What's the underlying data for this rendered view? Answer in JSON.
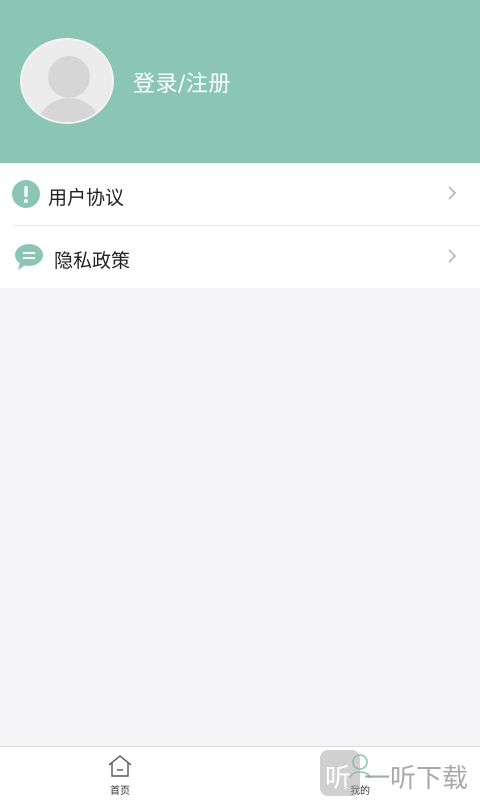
{
  "profile": {
    "login_label": "登录/注册"
  },
  "menu": {
    "items": [
      {
        "label": "用户协议",
        "icon": "exclamation-icon"
      },
      {
        "label": "隐私政策",
        "icon": "chat-bubble-icon"
      }
    ]
  },
  "tabbar": {
    "tabs": [
      {
        "label": "首页",
        "icon": "home-icon",
        "active": false
      },
      {
        "label": "我的",
        "icon": "user-icon",
        "active": true
      }
    ]
  },
  "watermark": {
    "text": "一听下载",
    "logo_glyph": "听"
  },
  "colors": {
    "accent": "#8ac6b3",
    "background": "#f5f4f7"
  }
}
